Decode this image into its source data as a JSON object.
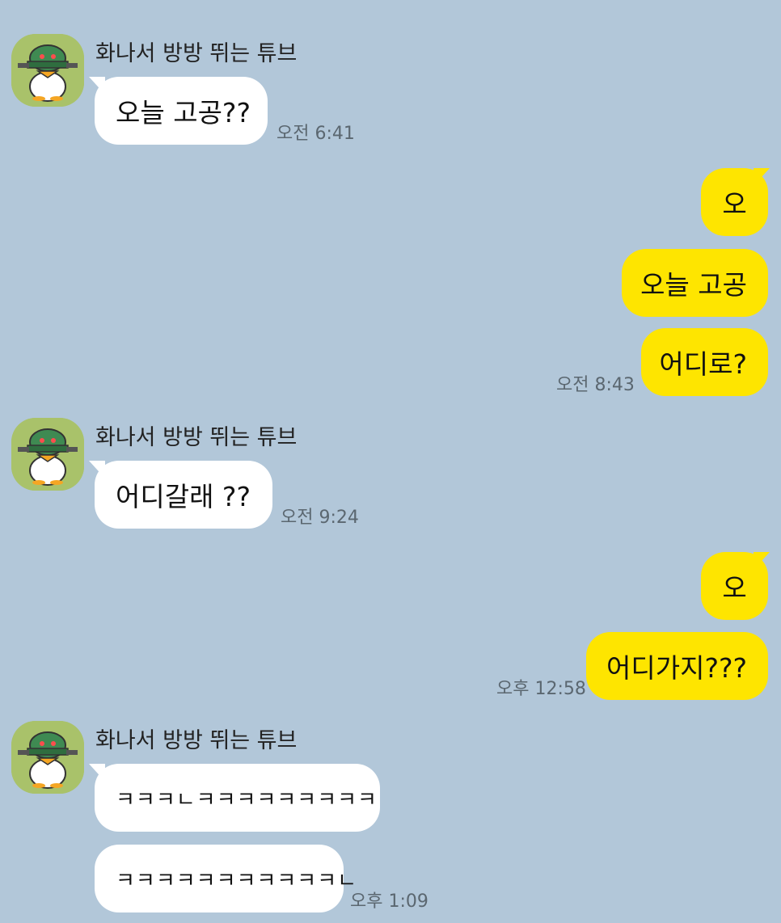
{
  "chat": {
    "background_color": "#b2c7d9",
    "my_bubble_color": "#fee500",
    "their_bubble_color": "#ffffff",
    "groups": [
      {
        "sender": "화나서 방방 뛰는 튜브",
        "avatar_icon": "tube-duck-avatar-icon",
        "messages": [
          "오늘 고공??"
        ],
        "time": "오전 6:41"
      },
      {
        "sender": "me",
        "messages": [
          "오",
          "오늘 고공",
          "어디로?"
        ],
        "time": "오전 8:43"
      },
      {
        "sender": "화나서 방방 뛰는 튜브",
        "avatar_icon": "tube-duck-avatar-icon",
        "messages": [
          "어디갈래 ??"
        ],
        "time": "오전 9:24"
      },
      {
        "sender": "me",
        "messages": [
          "오",
          "어디가지???"
        ],
        "time": "오후 12:58"
      },
      {
        "sender": "화나서 방방 뛰는 튜브",
        "avatar_icon": "tube-duck-avatar-icon",
        "messages": [
          "ㅋㅋㅋㄴㅋㅋㅋㅋㅋㅋㅋㅋㅋ",
          "ㅋㅋㅋㅋㅋㅋㅋㅋㅋㅋㅋㄴ"
        ],
        "time": "오후 1:09"
      }
    ]
  }
}
